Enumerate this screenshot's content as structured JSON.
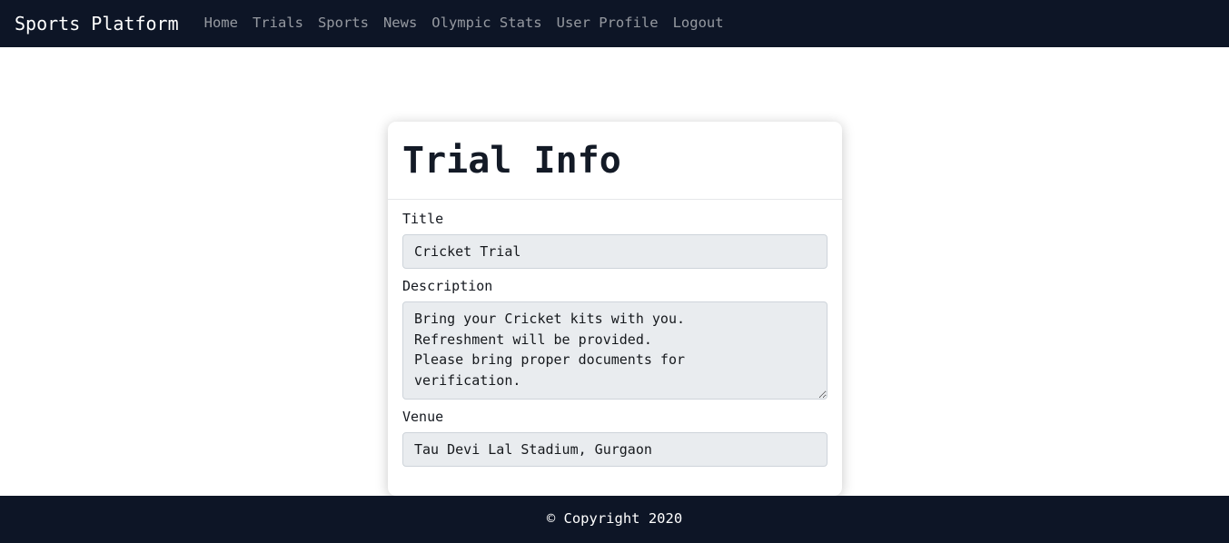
{
  "navbar": {
    "brand": "Sports Platform",
    "links": [
      {
        "label": "Home",
        "name": "nav-link-home"
      },
      {
        "label": "Trials",
        "name": "nav-link-trials"
      },
      {
        "label": "Sports",
        "name": "nav-link-sports"
      },
      {
        "label": "News",
        "name": "nav-link-news"
      },
      {
        "label": "Olympic Stats",
        "name": "nav-link-olympic-stats"
      },
      {
        "label": "User Profile",
        "name": "nav-link-user-profile"
      },
      {
        "label": "Logout",
        "name": "nav-link-logout"
      }
    ]
  },
  "card": {
    "title": "Trial Info",
    "fields": {
      "title": {
        "label": "Title",
        "value": "Cricket Trial"
      },
      "description": {
        "label": "Description",
        "value": "Bring your Cricket kits with you.\nRefreshment will be provided.\nPlease bring proper documents for\nverification."
      },
      "venue": {
        "label": "Venue",
        "value": "Tau Devi Lal Stadium, Gurgaon"
      }
    }
  },
  "footer": {
    "text": "© Copyright 2020"
  },
  "colors": {
    "navbar_bg": "#0d1526",
    "footer_bg": "#0d1526",
    "page_bg": "#ffffff",
    "card_bg": "#ffffff",
    "input_bg": "#e9ecef",
    "input_border": "#ced4da",
    "nav_link": "rgba(255,255,255,0.56)",
    "brand_text": "#ffffff",
    "heading_text": "#131a26"
  }
}
